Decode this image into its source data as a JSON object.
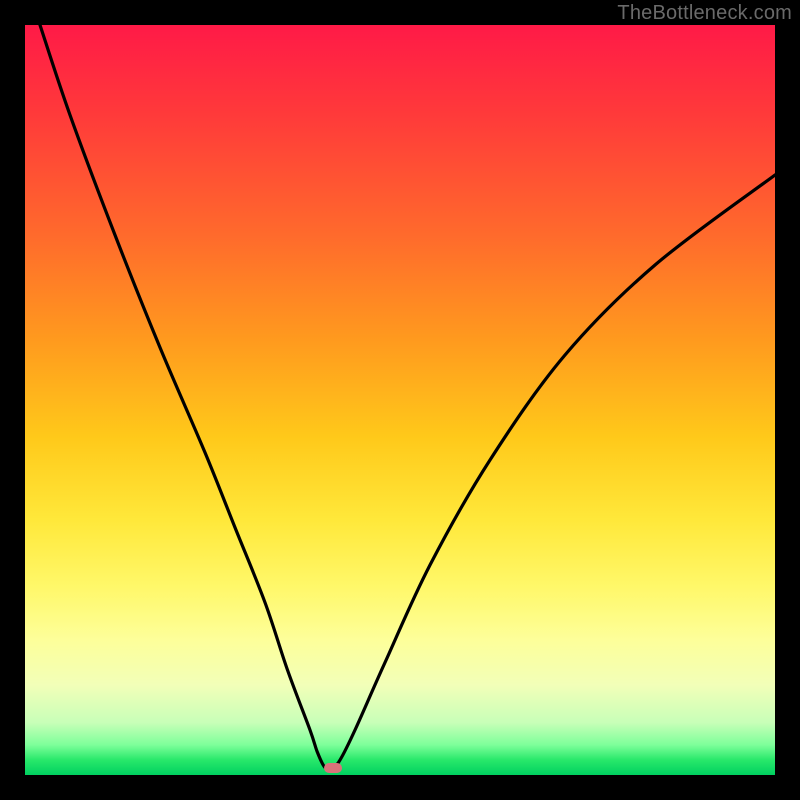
{
  "watermark": "TheBottleneck.com",
  "chart_data": {
    "type": "line",
    "title": "",
    "xlabel": "",
    "ylabel": "",
    "xlim": [
      0,
      100
    ],
    "ylim": [
      0,
      100
    ],
    "grid": false,
    "legend": false,
    "series": [
      {
        "name": "bottleneck-curve",
        "x": [
          2,
          6,
          12,
          18,
          24,
          28,
          32,
          35,
          38,
          39,
          40,
          41,
          42,
          44,
          48,
          54,
          62,
          72,
          84,
          100
        ],
        "y": [
          100,
          88,
          72,
          57,
          43,
          33,
          23,
          14,
          6,
          3,
          1,
          1,
          2,
          6,
          15,
          28,
          42,
          56,
          68,
          80
        ]
      }
    ],
    "marker": {
      "x": 41,
      "y": 1,
      "color": "#d9727a"
    },
    "background_gradient": {
      "direction": "top-to-bottom",
      "stops": [
        {
          "pos": 0,
          "color": "#ff1a47"
        },
        {
          "pos": 55,
          "color": "#ffc91a"
        },
        {
          "pos": 82,
          "color": "#fdff9a"
        },
        {
          "pos": 100,
          "color": "#00d060"
        }
      ]
    }
  }
}
